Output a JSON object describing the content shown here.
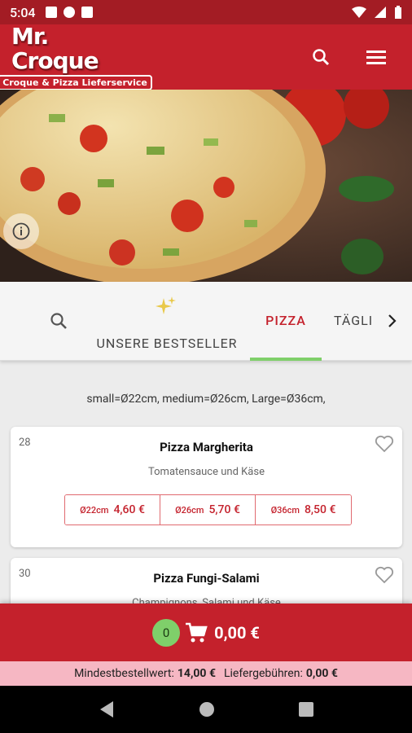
{
  "status": {
    "time": "5:04"
  },
  "app": {
    "logo_title": "Mr. Croque",
    "logo_sub": "Croque & Pizza Lieferservice"
  },
  "tabs": [
    {
      "label": "UNSERE BESTSELLER"
    },
    {
      "label": "PIZZA"
    },
    {
      "label": "TÄGLI"
    }
  ],
  "note": "small=Ø22cm, medium=Ø26cm, Large=Ø36cm,",
  "items": [
    {
      "number": "28",
      "name": "Pizza Margherita",
      "desc": "Tomatensauce und Käse",
      "sizes": [
        {
          "size": "Ø22cm",
          "price": "4,60 €"
        },
        {
          "size": "Ø26cm",
          "price": "5,70 €"
        },
        {
          "size": "Ø36cm",
          "price": "8,50 €"
        }
      ]
    },
    {
      "number": "30",
      "name": "Pizza Fungi-Salami",
      "desc": "Champignons, Salami und Käse"
    }
  ],
  "cart": {
    "count": "0",
    "total": "0,00 €"
  },
  "footer": {
    "min_label": "Mindestbestellwert:",
    "min_value": "14,00 €",
    "fee_label": "Liefergebühren:",
    "fee_value": "0,00 €"
  },
  "colors": {
    "brand": "#c4212c",
    "status": "#a31c24",
    "accent_green": "#7fcf6a",
    "info_strip": "#f6b7c3"
  }
}
